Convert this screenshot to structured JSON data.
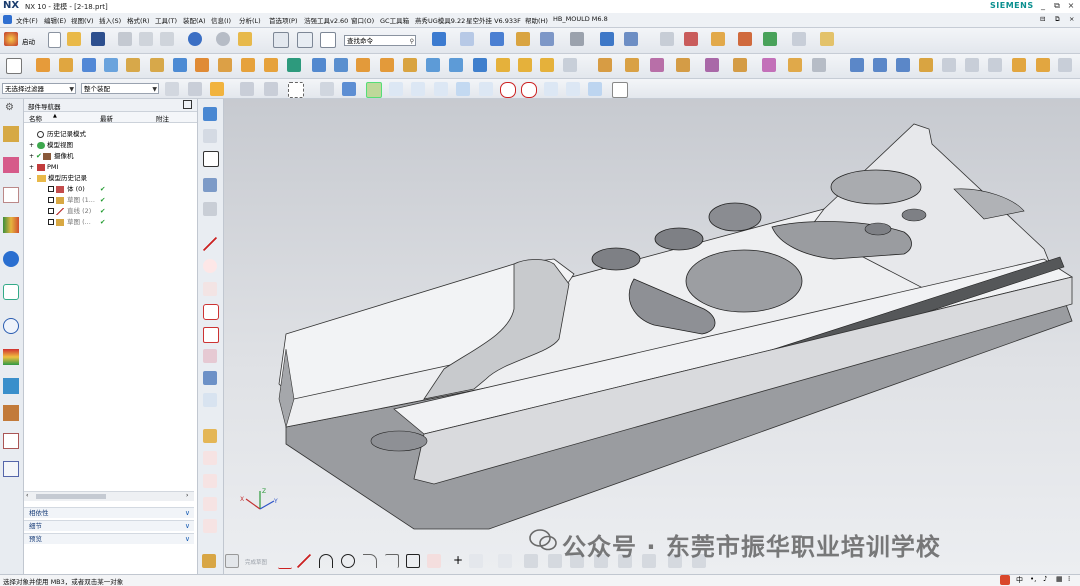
{
  "window": {
    "logo": "NX",
    "title": "NX 10 - 建模 - [2-18.prt]",
    "brand": "SIEMENS",
    "controls": [
      "_",
      "⧉",
      "×"
    ]
  },
  "menubar": {
    "items": [
      "文件(F)",
      "编辑(E)",
      "视图(V)",
      "插入(S)",
      "格式(R)",
      "工具(T)",
      "装配(A)",
      "信息(I)",
      "分析(L)",
      "首选项(P)",
      "浩强工具v2.60",
      "窗口(O)",
      "GC工具箱",
      "燕秀UG模具9.22",
      "星空外挂 V6.933F",
      "帮助(H)",
      "HB_MOULD M6.8"
    ],
    "mini_controls": [
      "⊟",
      "⧉",
      "×"
    ]
  },
  "toolbar1": {
    "start_label": "启动",
    "command_search_placeholder": "查找命令"
  },
  "filterbar": {
    "selection_filter": "无选择过滤器",
    "scope": "整个装配"
  },
  "navigator": {
    "title": "部件导航器",
    "columns": [
      "名称",
      "最新",
      "附注"
    ],
    "tree": [
      {
        "label": "历史记录模式",
        "indent": 0,
        "icon": "clock-icon",
        "check": false,
        "latest": ""
      },
      {
        "label": "模型视图",
        "indent": 0,
        "icon": "model-views-icon",
        "check": false,
        "latest": "",
        "expander": "+"
      },
      {
        "label": "摄像机",
        "indent": 0,
        "icon": "camera-icon",
        "check": true,
        "latest": "",
        "expander": "+"
      },
      {
        "label": "PMI",
        "indent": 0,
        "icon": "pmi-icon",
        "check": false,
        "latest": "",
        "expander": "+"
      },
      {
        "label": "模型历史记录",
        "indent": 0,
        "icon": "history-folder-icon",
        "check": false,
        "latest": "",
        "expander": "-"
      },
      {
        "label": "体 (0)",
        "indent": 1,
        "icon": "body-icon",
        "check": true,
        "latest": "✔"
      },
      {
        "label": "草图 (1...",
        "indent": 1,
        "icon": "sketch-icon",
        "check": true,
        "latest": "✔"
      },
      {
        "label": "直线 (2)",
        "indent": 1,
        "icon": "line-icon",
        "check": true,
        "latest": "✔"
      },
      {
        "label": "草图 (...",
        "indent": 1,
        "icon": "sketch-icon",
        "check": true,
        "latest": "✔"
      }
    ],
    "panels": [
      "相依性",
      "细节",
      "预览"
    ]
  },
  "bottom_toolbar": {
    "sketch_label": "完成草图"
  },
  "status": {
    "message": "选择对象并使用 MB3，或者双击某一对象"
  },
  "watermark": {
    "text": "公众号 · 东莞市振华职业培训学校"
  },
  "colors": {
    "accent": "#1b5fb4",
    "check_green": "#1e9a2c",
    "title_text": "#1a3c6e"
  }
}
